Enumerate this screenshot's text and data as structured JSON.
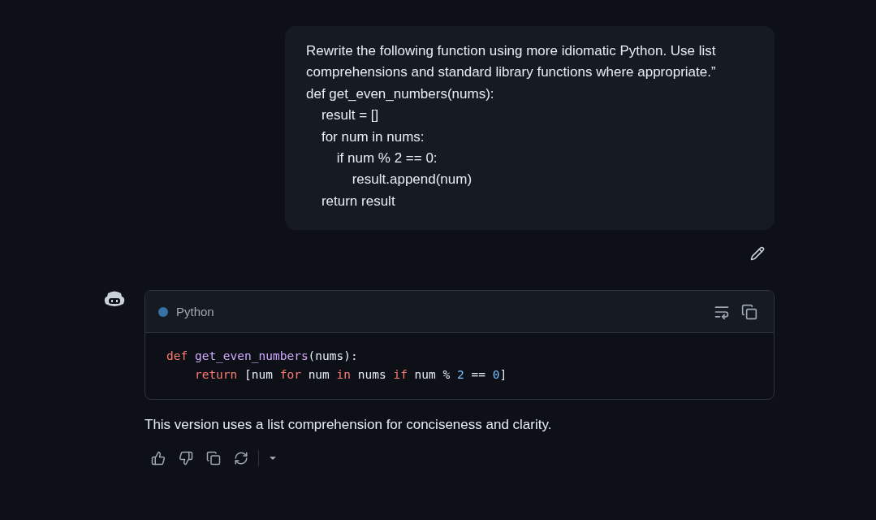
{
  "user_message": {
    "lines": [
      "Rewrite the following function using more idiomatic Python. Use list comprehensions and standard library functions where appropriate.”",
      "def get_even_numbers(nums):",
      "    result = []",
      "    for num in nums:",
      "        if num % 2 == 0:",
      "            result.append(num)",
      "    return result"
    ]
  },
  "code_block": {
    "language": "Python",
    "lines": [
      [
        {
          "kind": "keyword",
          "text": "def"
        },
        {
          "kind": "function",
          "text": " get_even_numbers"
        },
        {
          "kind": "plain",
          "text": "(nums):"
        }
      ],
      [
        {
          "kind": "keyword",
          "text": "    return"
        },
        {
          "kind": "plain",
          "text": " [num "
        },
        {
          "kind": "keyword",
          "text": "for"
        },
        {
          "kind": "plain",
          "text": " num "
        },
        {
          "kind": "keyword",
          "text": "in"
        },
        {
          "kind": "plain",
          "text": " nums "
        },
        {
          "kind": "keyword",
          "text": "if"
        },
        {
          "kind": "plain",
          "text": " num % "
        },
        {
          "kind": "number",
          "text": "2"
        },
        {
          "kind": "plain",
          "text": " == "
        },
        {
          "kind": "number",
          "text": "0"
        },
        {
          "kind": "plain",
          "text": "]"
        }
      ]
    ]
  },
  "response_text": "This version uses a list comprehension for conciseness and clarity."
}
